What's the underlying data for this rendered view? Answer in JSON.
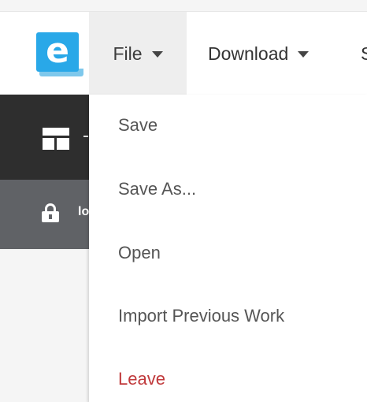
{
  "app": {
    "logo_letter": "e"
  },
  "topbar": {
    "file_label": "File",
    "download_label": "Download",
    "more_label": "S"
  },
  "sidebar": {
    "locked_label": "lo"
  },
  "file_menu": {
    "items": [
      {
        "label": "Save"
      },
      {
        "label": "Save As..."
      },
      {
        "label": "Open"
      },
      {
        "label": "Import Previous Work"
      },
      {
        "label": "Leave"
      }
    ]
  },
  "colors": {
    "brand": "#29a8e8",
    "leave": "#c0393b",
    "dark_panel": "#2e2e2e",
    "gray_panel": "#606266"
  }
}
